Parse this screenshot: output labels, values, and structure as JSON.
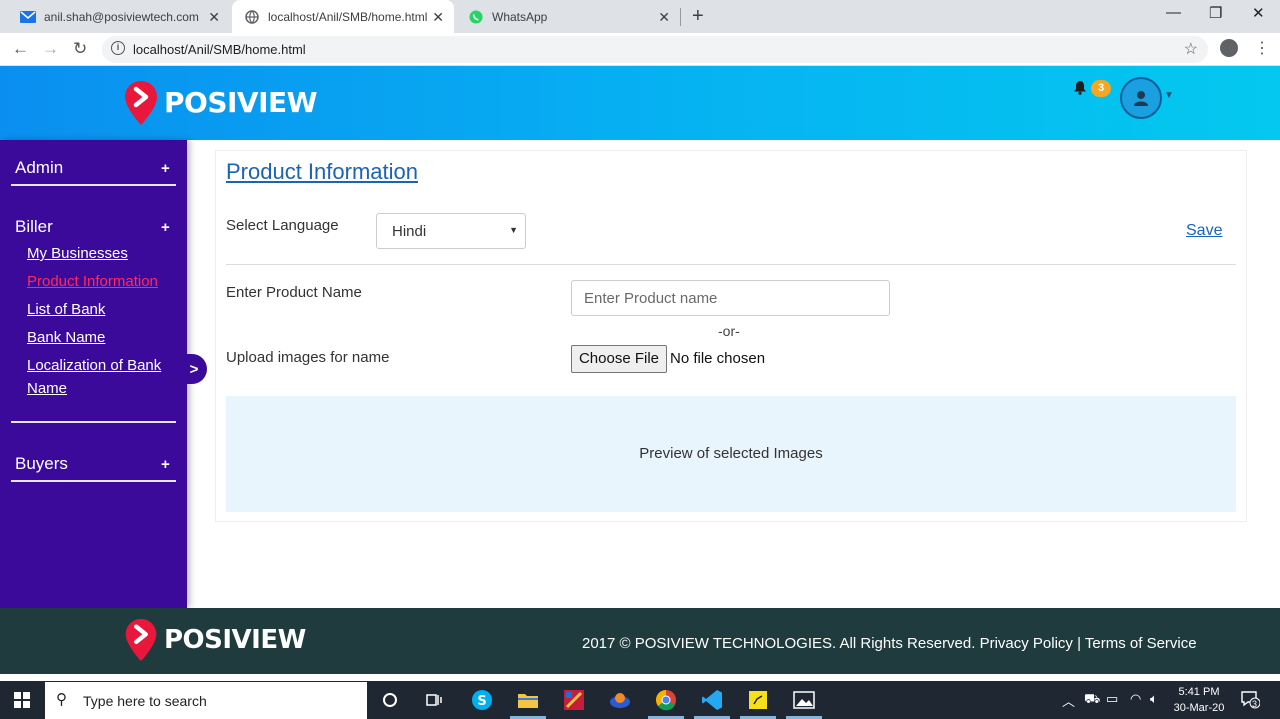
{
  "browser": {
    "tabs": [
      {
        "title": "anil.shah@posiviewtech.com",
        "icon": "mail-icon"
      },
      {
        "title": "localhost/Anil/SMB/home.html",
        "icon": "globe-icon"
      },
      {
        "title": "WhatsApp",
        "icon": "whatsapp-icon"
      }
    ],
    "url": "localhost/Anil/SMB/home.html"
  },
  "header": {
    "brand": "POSIVIEW",
    "notification_count": "3"
  },
  "sidebar": {
    "sections": [
      {
        "title": "Admin",
        "toggle": "+"
      },
      {
        "title": "Biller",
        "toggle": "+"
      },
      {
        "title": "Buyers",
        "toggle": "+"
      }
    ],
    "biller_links": [
      {
        "label": "My Businesses"
      },
      {
        "label": "Product Information"
      },
      {
        "label": "List of Bank"
      },
      {
        "label": "Bank Name"
      },
      {
        "label": "Localization of Bank",
        "label2": "Name"
      }
    ],
    "collapse_toggle": ">"
  },
  "main": {
    "title": "Product Information",
    "select_language_label": "Select Language",
    "language_value": "Hindi",
    "save_label": "Save",
    "product_name_label": "Enter Product Name",
    "product_name_placeholder": "Enter Product name",
    "or_text": "-or-",
    "upload_label": "Upload images for name",
    "choose_file_label": "Choose File",
    "file_status": "No file chosen",
    "preview_text": "Preview of selected Images"
  },
  "footer": {
    "brand": "POSIVIEW",
    "copyright": "2017 © POSIVIEW TECHNOLOGIES. All Rights Reserved. Privacy Policy | Terms of Service"
  },
  "taskbar": {
    "search_placeholder": "Type here to search",
    "time": "5:41 PM",
    "date": "30-Mar-20",
    "notification_count": "3"
  },
  "colors": {
    "header_gradient_start": "#0a8ff0",
    "header_gradient_end": "#04c8ef",
    "sidebar_bg": "#3c0a9a",
    "active_link": "#ff2a5a",
    "link_blue": "#1a63b8",
    "footer_bg": "#203b3d",
    "logo_red": "#e8173b"
  }
}
